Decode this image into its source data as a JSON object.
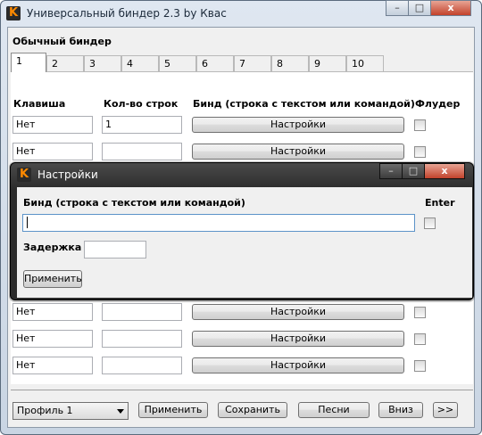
{
  "window": {
    "title": "Универсальный биндер 2.3 by Квас",
    "app_icon_glyph": "K",
    "minimize_glyph": "–",
    "maximize_glyph": "□",
    "close_glyph": "x"
  },
  "group": {
    "title": "Обычный биндер"
  },
  "tabs": [
    "1",
    "2",
    "3",
    "4",
    "5",
    "6",
    "7",
    "8",
    "9",
    "10"
  ],
  "columns": {
    "key": "Клавиша",
    "lines": "Кол-во строк",
    "bind": "Бинд (строка с текстом или командой)",
    "flood": "Флудер"
  },
  "rows": [
    {
      "key": "Нет",
      "lines": "1",
      "settings": "Настройки"
    },
    {
      "key": "Нет",
      "lines": "",
      "settings": "Настройки"
    },
    {
      "key": "Нет",
      "lines": "",
      "settings": "Настройки"
    },
    {
      "key": "Нет",
      "lines": "",
      "settings": "Настройки"
    },
    {
      "key": "Нет",
      "lines": "",
      "settings": "Настройки"
    }
  ],
  "dialog": {
    "title": "Настройки",
    "bind_label": "Бинд (строка с текстом или командой)",
    "enter_label": "Enter",
    "bind_value": "",
    "delay_label": "Задержка",
    "delay_value": "",
    "apply": "Применить"
  },
  "footer": {
    "profile": "Профиль 1",
    "apply": "Применить",
    "save": "Сохранить",
    "songs": "Песни",
    "down": "Вниз",
    "more": ">>"
  },
  "colors": {
    "icon_accent": "#ff8a00",
    "close_red": "#c2422b",
    "dialog_frame": "#2b2b2b"
  }
}
